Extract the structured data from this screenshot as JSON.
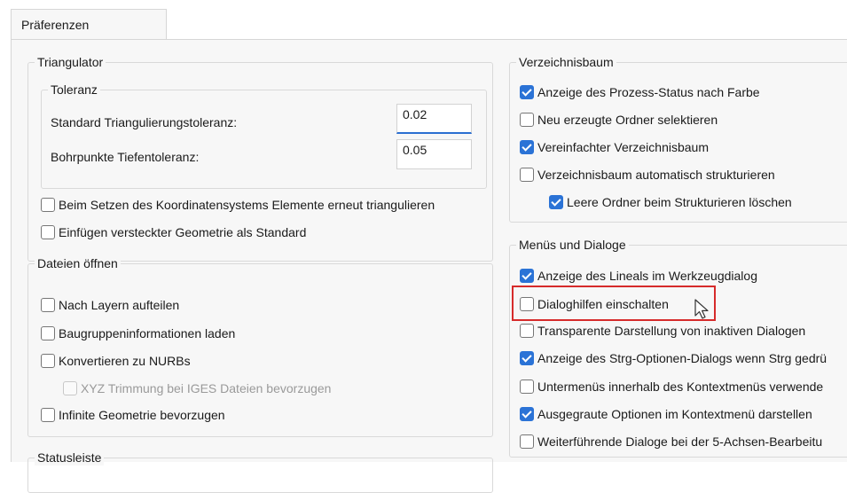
{
  "tab": {
    "label": "Präferenzen"
  },
  "triangulator": {
    "title": "Triangulator",
    "toleranz": {
      "title": "Toleranz",
      "standard_label": "Standard Triangulierungstoleranz:",
      "standard_value": "0.02",
      "bohr_label": "Bohrpunkte Tiefentoleranz:",
      "bohr_value": "0.05"
    },
    "options": [
      {
        "label": "Beim Setzen des Koordinatensystems Elemente erneut triangulieren",
        "checked": false
      },
      {
        "label": "Einfügen versteckter Geometrie als Standard",
        "checked": false
      }
    ]
  },
  "dateien": {
    "title": "Dateien öffnen",
    "options": [
      {
        "label": "Nach Layern aufteilen",
        "checked": false
      },
      {
        "label": "Baugruppeninformationen laden",
        "checked": false
      },
      {
        "label": "Konvertieren zu NURBs",
        "checked": false
      },
      {
        "label": "XYZ Trimmung bei IGES Dateien bevorzugen",
        "checked": false,
        "disabled": true
      },
      {
        "label": "Infinite Geometrie bevorzugen",
        "checked": false
      }
    ]
  },
  "statusleiste": {
    "title": "Statusleiste"
  },
  "verzeichnisbaum": {
    "title": "Verzeichnisbaum",
    "options": [
      {
        "label": "Anzeige des Prozess-Status nach Farbe",
        "checked": true
      },
      {
        "label": "Neu erzeugte Ordner selektieren",
        "checked": false
      },
      {
        "label": "Vereinfachter Verzeichnisbaum",
        "checked": true
      },
      {
        "label": "Verzeichnisbaum automatisch strukturieren",
        "checked": false
      },
      {
        "label": "Leere Ordner beim Strukturieren löschen",
        "checked": true
      }
    ]
  },
  "menus": {
    "title": "Menüs und Dialoge",
    "options": [
      {
        "label": "Anzeige des Lineals im Werkzeugdialog",
        "checked": true
      },
      {
        "label": "Dialoghilfen einschalten",
        "checked": false
      },
      {
        "label": "Transparente Darstellung von inaktiven Dialogen",
        "checked": false
      },
      {
        "label": "Anzeige des Strg-Optionen-Dialogs wenn Strg gedrü",
        "checked": true
      },
      {
        "label": "Untermenüs innerhalb des Kontextmenüs verwende",
        "checked": false
      },
      {
        "label": "Ausgegraute Optionen im Kontextmenü darstellen",
        "checked": true
      },
      {
        "label": "Weiterführende Dialoge bei der 5-Achsen-Bearbeitu",
        "checked": false
      }
    ]
  },
  "colors": {
    "accent": "#2b73d6",
    "highlight": "#d62b2b",
    "panel": "#f7f7f7"
  }
}
